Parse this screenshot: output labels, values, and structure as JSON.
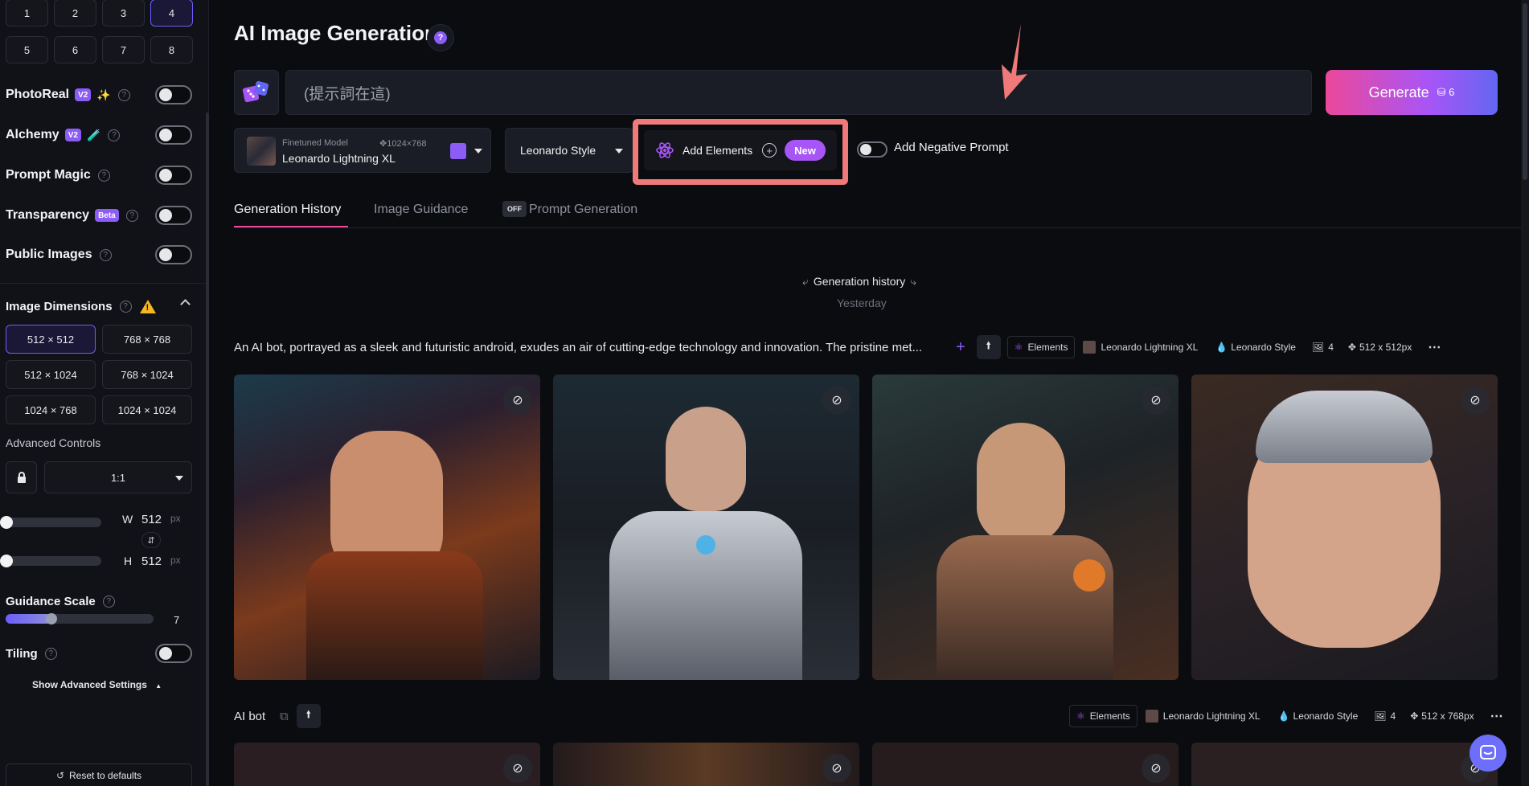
{
  "sidebar": {
    "image_counts": [
      "1",
      "2",
      "3",
      "4",
      "5",
      "6",
      "7",
      "8"
    ],
    "selected_count": "4",
    "toggles": [
      {
        "label": "PhotoReal",
        "badge": "V2",
        "emoji": "✨"
      },
      {
        "label": "Alchemy",
        "badge": "V2",
        "emoji": "🧪"
      },
      {
        "label": "Prompt Magic",
        "badge": "",
        "emoji": ""
      },
      {
        "label": "Transparency",
        "badge": "Beta",
        "emoji": ""
      },
      {
        "label": "Public Images",
        "badge": "",
        "emoji": ""
      }
    ],
    "dimensions_label": "Image Dimensions",
    "dimensions": [
      "512 × 512",
      "768 × 768",
      "512 × 1024",
      "768 × 1024",
      "1024 × 768",
      "1024 × 1024"
    ],
    "selected_dimension": "512 × 512",
    "advanced_controls_label": "Advanced Controls",
    "aspect_ratio": "1:1",
    "width_label": "W",
    "width_value": "512",
    "height_label": "H",
    "height_value": "512",
    "unit": "px",
    "guidance_scale_label": "Guidance Scale",
    "guidance_scale_value": "7",
    "guidance_scale_fraction": 0.31,
    "tiling_label": "Tiling",
    "show_advanced_label": "Show Advanced Settings",
    "reset_label": "Reset to defaults"
  },
  "header": {
    "title": "AI Image Generation",
    "prompt_placeholder": "(提示詞在這)",
    "generate_label": "Generate",
    "generate_tokens": "6"
  },
  "model": {
    "sub_label": "Finetuned Model",
    "resolution": "1024×768",
    "name": "Leonardo Lightning XL"
  },
  "style": {
    "label": "Leonardo Style"
  },
  "elements": {
    "label": "Add Elements",
    "new_badge": "New"
  },
  "negative_prompt": {
    "label": "Add Negative Prompt"
  },
  "tabs": [
    {
      "label": "Generation History"
    },
    {
      "label": "Image Guidance",
      "badge": "OFF"
    },
    {
      "label": "Prompt Generation"
    }
  ],
  "history": {
    "title": "Generation history",
    "subtitle": "Yesterday",
    "rows": [
      {
        "description": "An AI bot, portrayed as a sleek and futuristic android, exudes an air of cutting-edge technology and innovation. The pristine met...",
        "elements": "Elements",
        "model": "Leonardo Lightning XL",
        "style": "Leonardo Style",
        "count": "4",
        "size": "512 x 512px"
      },
      {
        "description": "AI bot",
        "elements": "Elements",
        "model": "Leonardo Lightning XL",
        "style": "Leonardo Style",
        "count": "4",
        "size": "512 x 768px"
      }
    ]
  },
  "colors": {
    "accent": "#8b5cf6",
    "highlight": "#f07a7a",
    "generate_start": "#ec4899",
    "generate_end": "#6366f1"
  }
}
